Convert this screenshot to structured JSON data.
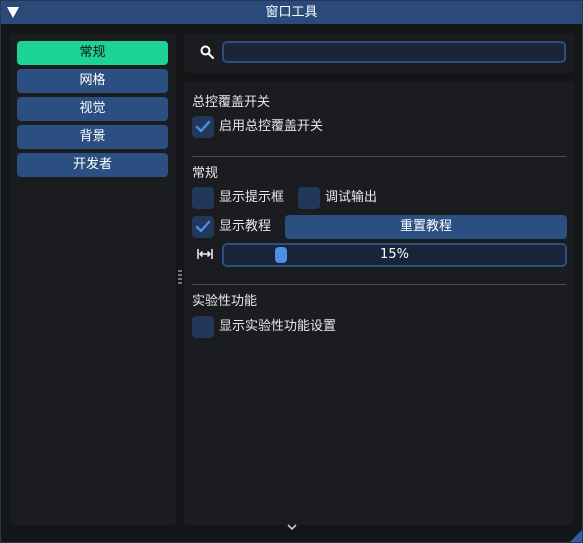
{
  "window": {
    "title": "窗口工具"
  },
  "sidebar": {
    "items": [
      {
        "label": "常规",
        "active": true
      },
      {
        "label": "网格",
        "active": false
      },
      {
        "label": "视觉",
        "active": false
      },
      {
        "label": "背景",
        "active": false
      },
      {
        "label": "开发者",
        "active": false
      }
    ]
  },
  "search": {
    "value": "",
    "placeholder": ""
  },
  "sections": {
    "master": {
      "title": "总控覆盖开关",
      "enable_label": "启用总控覆盖开关",
      "enable_checked": true
    },
    "general": {
      "title": "常规",
      "show_tooltips_label": "显示提示框",
      "show_tooltips_checked": false,
      "debug_output_label": "调试输出",
      "debug_output_checked": false,
      "show_tutorial_label": "显示教程",
      "show_tutorial_checked": true,
      "reset_tutorial_label": "重置教程",
      "width_slider_value": "15%",
      "width_slider_fraction": 0.15
    },
    "experimental": {
      "title": "实验性功能",
      "show_experimental_label": "显示实验性功能设置",
      "show_experimental_checked": false
    }
  },
  "colors": {
    "accent": "#2c4f82",
    "active_tab": "#1ed495",
    "check": "#4d8fe8",
    "titlebar": "#2a4a7a"
  }
}
